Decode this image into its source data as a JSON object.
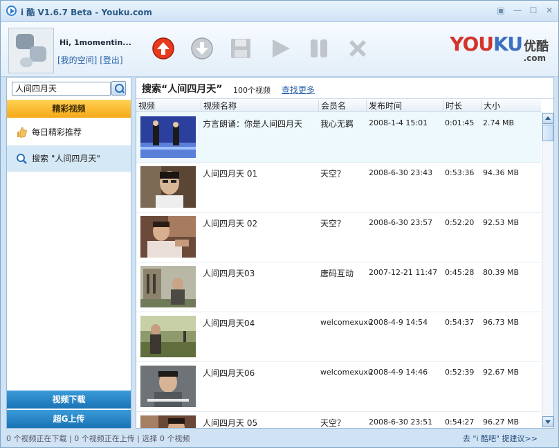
{
  "window": {
    "title": "i 酷 V1.6.7 Beta - Youku.com",
    "controls": [
      "restore-icon",
      "minimize-icon",
      "maximize-icon",
      "close-icon"
    ]
  },
  "header": {
    "greeting": "Hi, 1momentin...",
    "my_space": "[我的空间]",
    "logout": "[登出]",
    "toolbar": [
      "upload-arrow-icon",
      "download-arrow-icon",
      "save-disk-icon",
      "play-icon",
      "pause-icon",
      "delete-x-icon"
    ],
    "logo": {
      "you": "YOU",
      "ku": "KU",
      "cn": "优酷",
      "com": ".com"
    }
  },
  "sidebar": {
    "search_value": "人间四月天",
    "section_title": "精彩视频",
    "items": [
      {
        "label": "每日精彩推荐",
        "icon": "thumbs-up-icon"
      },
      {
        "label": "搜索 \"人间四月天\"",
        "icon": "search-icon"
      }
    ],
    "bottom_buttons": [
      "视频下载",
      "超G上传"
    ]
  },
  "main": {
    "query_title": "搜索“人间四月天”",
    "count": "100个视频",
    "more_link": "查找更多",
    "columns": [
      "视频",
      "视频名称",
      "会员名",
      "发布时间",
      "时长",
      "大小"
    ],
    "rows": [
      {
        "name": "方言朗诵：你是人间四月天",
        "user": "我心无羁",
        "date": "2008-1-4 15:01",
        "duration": "0:01:45",
        "size": "2.74 MB"
      },
      {
        "name": "人间四月天 01",
        "user": "天空？",
        "date": "2008-6-30 23:43",
        "duration": "0:53:36",
        "size": "94.36 MB"
      },
      {
        "name": "人间四月天 02",
        "user": "天空？",
        "date": "2008-6-30 23:57",
        "duration": "0:52:20",
        "size": "92.53 MB"
      },
      {
        "name": "人间四月天03",
        "user": "唐码互动",
        "date": "2007-12-21 11:47",
        "duration": "0:45:28",
        "size": "80.39 MB"
      },
      {
        "name": "人间四月天04",
        "user": "welcomexuxu",
        "date": "2008-4-9 14:54",
        "duration": "0:54:37",
        "size": "96.73 MB"
      },
      {
        "name": "人间四月天06",
        "user": "welcomexuxu",
        "date": "2008-4-9 14:46",
        "duration": "0:52:39",
        "size": "92.67 MB"
      },
      {
        "name": "人间四月天 05",
        "user": "天空？",
        "date": "2008-6-30 23:51",
        "duration": "0:54:27",
        "size": "96.27 MB"
      }
    ]
  },
  "status": {
    "left": "0 个视频正在下载 | 0 个视频正在上传 | 选择 0 个视频",
    "right": "去 \"i 酷吧\" 提建议>>"
  }
}
